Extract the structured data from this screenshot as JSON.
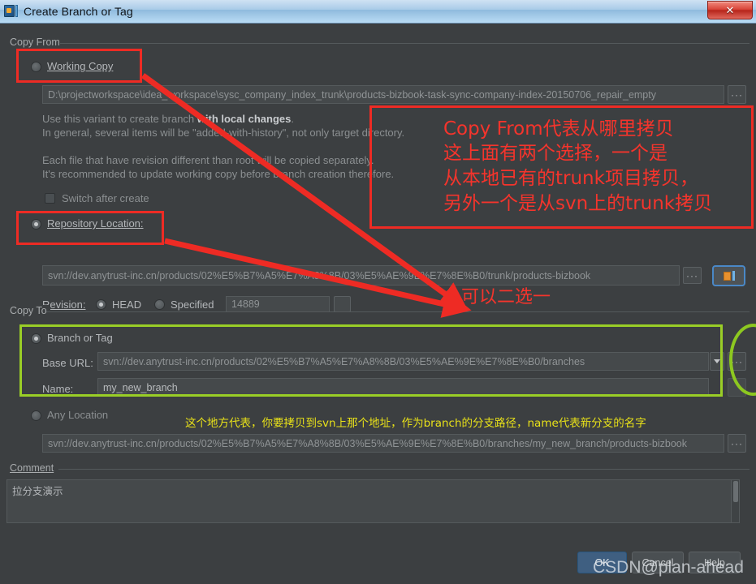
{
  "window": {
    "title": "Create Branch or Tag",
    "icon": "idea-svn-icon",
    "close_label": "✕"
  },
  "copy_from": {
    "group_label": "Copy From",
    "working_copy": {
      "label": "Working Copy",
      "selected": false,
      "path": "D:\\projectworkspace\\idea_workspace\\sysc_company_index_trunk\\products-bizbook-task-sync-company-index-20150706_repair_empty",
      "browse_label": "···"
    },
    "description": [
      "Use this variant to create branch with local changes.",
      "In general, several items will be \"added-with-history\", not only target directory.",
      "",
      "Each file that have revision different than root will be copied separately.",
      "It's recommended to update working copy before branch creation therefore."
    ],
    "description_rich": {
      "line1_pre": "Use this variant to create branch ",
      "line1_bold": "with local changes",
      "line1_post": ".",
      "line2": "In general, several items will be \"added-with-history\", not only target directory.",
      "line3": "Each file that have revision different than root will be copied separately.",
      "line4": "It's recommended to update working copy before branch creation therefore."
    },
    "switch_after_create": {
      "label": "Switch after create",
      "checked": false
    },
    "repository_location": {
      "label": "Repository Location:",
      "selected": true,
      "url": "svn://dev.anytrust-inc.cn/products/02%E5%B7%A5%E7%A8%8B/03%E5%AE%9E%E7%8E%B0/trunk/products-bizbook",
      "browse_label": "···",
      "select_icon": "repository-browse-icon"
    },
    "revision": {
      "label": "Revision:",
      "head_label": "HEAD",
      "head_selected": true,
      "specified_label": "Specified",
      "specified_selected": false,
      "value": "14889",
      "browse_label": ""
    }
  },
  "copy_to": {
    "group_label": "Copy To",
    "branch_or_tag": {
      "label": "Branch or Tag",
      "selected": true,
      "base_url_label": "Base URL:",
      "base_url": "svn://dev.anytrust-inc.cn/products/02%E5%B7%A5%E7%A8%8B/03%E5%AE%9E%E7%8E%B0/branches",
      "dropdown_icon": "chevron-down-icon",
      "browse_label": "···",
      "name_label": "Name:",
      "name_value": "my_new_branch"
    },
    "any_location": {
      "label": "Any Location",
      "selected": false,
      "url": "svn://dev.anytrust-inc.cn/products/02%E5%B7%A5%E7%A8%8B/03%E5%AE%9E%E7%8E%B0/branches/my_new_branch/products-bizbook",
      "browse_label": "···"
    }
  },
  "comment": {
    "group_label": "Comment",
    "value": "拉分支演示"
  },
  "buttons": {
    "ok": "OK",
    "cancel": "Cancel",
    "help": "Help"
  },
  "annotations": {
    "copy_from_note": [
      "Copy From代表从哪里拷贝",
      "这上面有两个选择，一个是",
      "从本地已有的trunk项目拷贝，",
      "另外一个是从svn上的trunk拷贝"
    ],
    "choose_one": "可以二选一",
    "copy_to_note": "这个地方代表，你要拷贝到svn上那个地址，作为branch的分支路径，name代表新分支的名字",
    "colors": {
      "red": "#ee2b24",
      "green": "#9ace26",
      "yellow": "#e8e119"
    }
  },
  "watermark": "CSDN@plan-ahead"
}
